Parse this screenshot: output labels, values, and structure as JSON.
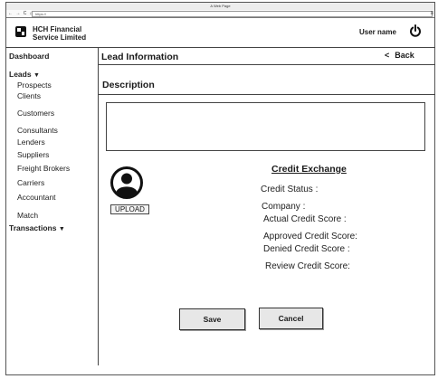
{
  "browser": {
    "window_title": "A Web Page",
    "nav_glyphs": "← → C  ⌂",
    "url": "https://",
    "menu_glyph": "≡"
  },
  "header": {
    "company_line1": "HCH Financial",
    "company_line2": "Service Limited",
    "user_name": "User name",
    "logout_icon": "power-icon"
  },
  "sidebar": {
    "dashboard": "Dashboard",
    "leads": "Leads",
    "leads_caret": "▼",
    "items": [
      "Prospects",
      "Clients",
      "Customers",
      "Consultants",
      "Lenders",
      "Suppliers",
      "Freight Brokers",
      "Carriers",
      "Accountant",
      "Match"
    ],
    "transactions": "Transactions",
    "transactions_caret": "▼"
  },
  "main": {
    "title": "Lead Information",
    "back_label": "Back",
    "back_glyph": "<",
    "description_heading": "Description",
    "description_value": "",
    "upload_label": "UPLOAD",
    "avatar_icon": "user-avatar-icon",
    "credit_exchange": {
      "title": "Credit Exchange",
      "credit_status": "Credit Status :",
      "company": "Company :",
      "actual_score": "Actual Credit Score :",
      "approved_score": "Approved Credit Score:",
      "denied_score": "Denied Credit Score :",
      "review_score": "Review Credit Score:"
    },
    "save_label": "Save",
    "cancel_label": "Cancel"
  }
}
